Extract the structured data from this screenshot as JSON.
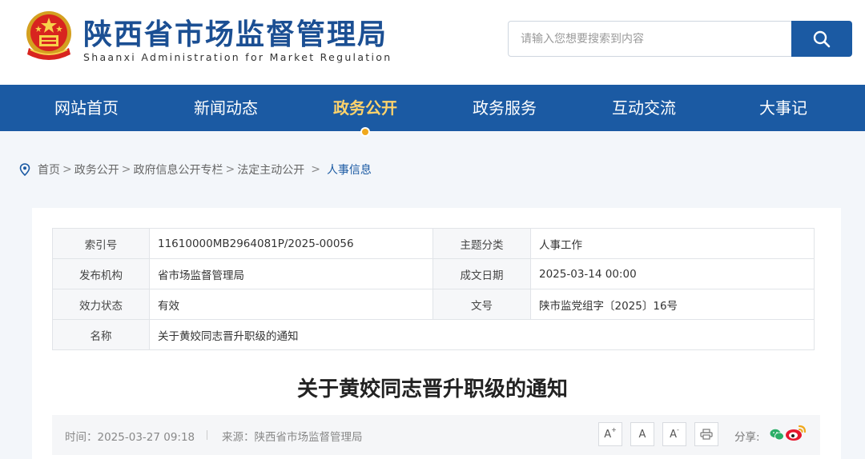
{
  "header": {
    "title": "陕西省市场监督管理局",
    "subtitle": "Shaanxi Administration for Market Regulation",
    "search_placeholder": "请输入您想要搜索到内容"
  },
  "nav": {
    "items": [
      "网站首页",
      "新闻动态",
      "政务公开",
      "政务服务",
      "互动交流",
      "大事记"
    ],
    "active_index": 2
  },
  "breadcrumb": {
    "items": [
      "首页",
      "政务公开",
      "政府信息公开专栏",
      "法定主动公开"
    ],
    "current": "人事信息",
    "separator": ">"
  },
  "meta": {
    "index_label": "索引号",
    "index_value": "11610000MB2964081P/2025-00056",
    "topic_label": "主题分类",
    "topic_value": "人事工作",
    "publisher_label": "发布机构",
    "publisher_value": "省市场监督管理局",
    "date_label": "成文日期",
    "date_value": "2025-03-14 00:00",
    "status_label": "效力状态",
    "status_value": "有效",
    "docno_label": "文号",
    "docno_value": "陕市监党组字〔2025〕16号",
    "name_label": "名称",
    "name_value": "关于黄姣同志晋升职级的通知"
  },
  "article": {
    "title": "关于黄姣同志晋升职级的通知",
    "time": "时间：2025-03-27 09:18",
    "source": "来源：陕西省市场监督管理局",
    "font_larger": "A",
    "font_normal": "A",
    "font_smaller": "A",
    "plus": "+",
    "minus": "-",
    "share_label": "分享:"
  },
  "colors": {
    "brand_blue": "#1b5aa3",
    "title_blue": "#1b4f93",
    "active_nav": "#ffd36b",
    "weibo_red": "#e6162d",
    "wechat_green": "#2aae67"
  },
  "icons": [
    "national-emblem-icon",
    "search-icon",
    "location-pin-icon",
    "print-icon",
    "wechat-icon",
    "weibo-icon"
  ]
}
